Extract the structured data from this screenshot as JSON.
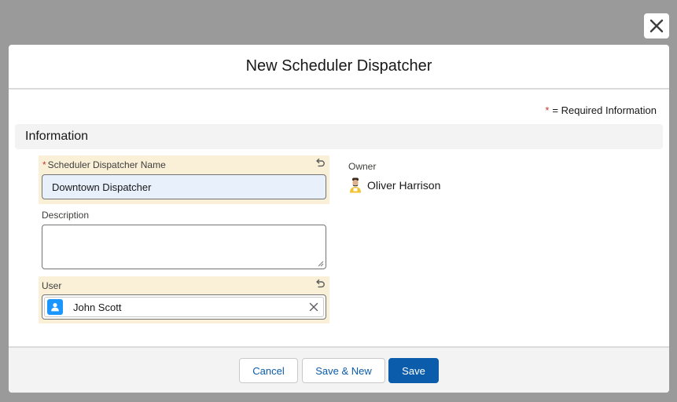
{
  "modal": {
    "title": "New Scheduler Dispatcher",
    "close_icon": "close-icon"
  },
  "legend": {
    "star": "*",
    "text": "= Required Information"
  },
  "section": {
    "title": "Information"
  },
  "fields": {
    "name": {
      "required_marker": "*",
      "label": "Scheduler Dispatcher Name",
      "value": "Downtown Dispatcher",
      "undo_icon": "undo-icon"
    },
    "description": {
      "label": "Description",
      "value": ""
    },
    "user": {
      "label": "User",
      "value": "John Scott",
      "entity_icon": "user-icon",
      "clear_icon": "clear-icon",
      "undo_icon": "undo-icon"
    },
    "owner": {
      "label": "Owner",
      "value": "Oliver Harrison",
      "avatar_icon": "avatar-icon"
    }
  },
  "footer": {
    "cancel_label": "Cancel",
    "save_new_label": "Save & New",
    "save_label": "Save"
  },
  "colors": {
    "brand": "#0b5cab",
    "required": "#c23934",
    "edited_highlight": "#faf0d8",
    "autofill_input": "#e8f0fc",
    "backdrop": "#9a9a9a"
  }
}
